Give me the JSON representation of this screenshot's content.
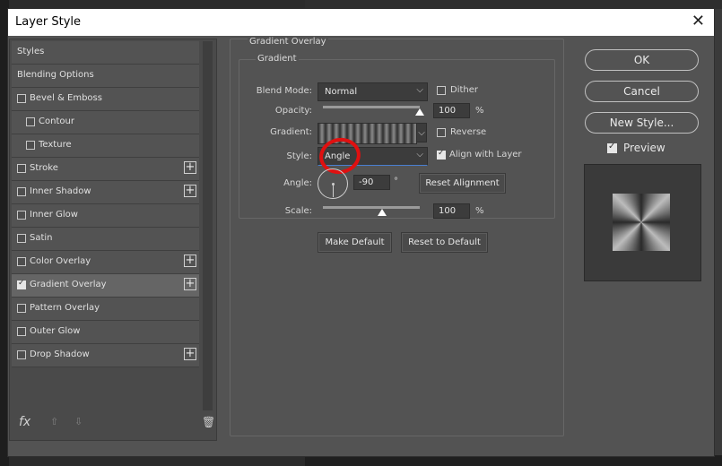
{
  "window": {
    "title": "Layer Style",
    "close_glyph": "✕"
  },
  "sidebar": {
    "items": [
      {
        "label": "Styles"
      },
      {
        "label": "Blending Options"
      },
      {
        "label": "Bevel & Emboss",
        "checked": false
      },
      {
        "label": "Contour",
        "checked": false
      },
      {
        "label": "Texture",
        "checked": false
      },
      {
        "label": "Stroke",
        "checked": false,
        "plus": true
      },
      {
        "label": "Inner Shadow",
        "checked": false,
        "plus": true
      },
      {
        "label": "Inner Glow",
        "checked": false
      },
      {
        "label": "Satin",
        "checked": false
      },
      {
        "label": "Color Overlay",
        "checked": false,
        "plus": true
      },
      {
        "label": "Gradient Overlay",
        "checked": true,
        "plus": true,
        "selected": true
      },
      {
        "label": "Pattern Overlay",
        "checked": false
      },
      {
        "label": "Outer Glow",
        "checked": false
      },
      {
        "label": "Drop Shadow",
        "checked": false,
        "plus": true
      }
    ],
    "plus_glyph": "+",
    "fx_label": "fx",
    "up_glyph": "⇧",
    "down_glyph": "⇩",
    "trash_glyph": "🗑"
  },
  "panel": {
    "group_title": "Gradient Overlay",
    "sub_title": "Gradient",
    "blend_mode_label": "Blend Mode:",
    "blend_mode_value": "Normal",
    "dither_label": "Dither",
    "opacity_label": "Opacity:",
    "opacity_value": "100",
    "opacity_unit": "%",
    "opacity_level": 1.0,
    "gradient_label": "Gradient:",
    "reverse_label": "Reverse",
    "style_label": "Style:",
    "style_value": "Angle",
    "align_label": "Align with Layer",
    "align_checked": true,
    "angle_label": "Angle:",
    "angle_value": "-90",
    "angle_unit": "°",
    "reset_alignment": "Reset Alignment",
    "scale_label": "Scale:",
    "scale_value": "100",
    "scale_unit": "%",
    "make_default": "Make Default",
    "reset_default": "Reset to Default",
    "chevron": "⌵"
  },
  "actions": {
    "ok": "OK",
    "cancel": "Cancel",
    "new_style": "New Style...",
    "preview_label": "Preview",
    "preview_checked": true
  }
}
